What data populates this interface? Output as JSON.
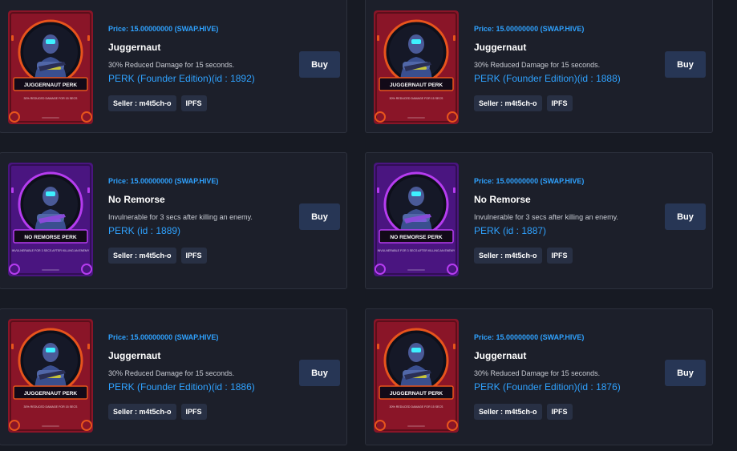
{
  "listings": [
    {
      "price": "Price: 15.00000000 (SWAP.HIVE)",
      "title": "Juggernaut",
      "description": "30% Reduced Damage for 15 seconds.",
      "nft": "PERK (Founder Edition)(id : 1892)",
      "seller": "Seller : m4t5ch-o",
      "ipfs": "IPFS",
      "buy": "Buy",
      "card_banner": "JUGGERNAUT PERK",
      "card_text": "30% REDUCED DAMAGE FOR 15 SECS",
      "theme": "juggernaut"
    },
    {
      "price": "Price: 15.00000000 (SWAP.HIVE)",
      "title": "Juggernaut",
      "description": "30% Reduced Damage for 15 seconds.",
      "nft": "PERK (Founder Edition)(id : 1888)",
      "seller": "Seller : m4t5ch-o",
      "ipfs": "IPFS",
      "buy": "Buy",
      "card_banner": "JUGGERNAUT PERK",
      "card_text": "30% REDUCED DAMAGE FOR 15 SECS",
      "theme": "juggernaut"
    },
    {
      "price": "Price: 15.00000000 (SWAP.HIVE)",
      "title": "No Remorse",
      "description": "Invulnerable for 3 secs after killing an enemy.",
      "nft": "PERK (id : 1889)",
      "seller": "Seller : m4t5ch-o",
      "ipfs": "IPFS",
      "buy": "Buy",
      "card_banner": "NO REMORSE PERK",
      "card_text": "INVULNERABLE FOR 3 SECS AFTER KILLING AN ENEMY",
      "theme": "remorse"
    },
    {
      "price": "Price: 15.00000000 (SWAP.HIVE)",
      "title": "No Remorse",
      "description": "Invulnerable for 3 secs after killing an enemy.",
      "nft": "PERK (id : 1887)",
      "seller": "Seller : m4t5ch-o",
      "ipfs": "IPFS",
      "buy": "Buy",
      "card_banner": "NO REMORSE PERK",
      "card_text": "INVULNERABLE FOR 3 SECS AFTER KILLING AN ENEMY",
      "theme": "remorse"
    },
    {
      "price": "Price: 15.00000000 (SWAP.HIVE)",
      "title": "Juggernaut",
      "description": "30% Reduced Damage for 15 seconds.",
      "nft": "PERK (Founder Edition)(id : 1886)",
      "seller": "Seller : m4t5ch-o",
      "ipfs": "IPFS",
      "buy": "Buy",
      "card_banner": "JUGGERNAUT PERK",
      "card_text": "30% REDUCED DAMAGE FOR 15 SECS",
      "theme": "juggernaut"
    },
    {
      "price": "Price: 15.00000000 (SWAP.HIVE)",
      "title": "Juggernaut",
      "description": "30% Reduced Damage for 15 seconds.",
      "nft": "PERK (Founder Edition)(id : 1876)",
      "seller": "Seller : m4t5ch-o",
      "ipfs": "IPFS",
      "buy": "Buy",
      "card_banner": "JUGGERNAUT PERK",
      "card_text": "30% REDUCED DAMAGE FOR 15 SECS",
      "theme": "juggernaut"
    }
  ],
  "colors": {
    "price": "#2fa2ff",
    "link": "#2fa2ff",
    "button": "#273655",
    "tag": "#283044",
    "juggernaut_bg": "#8a1528",
    "juggernaut_accent": "#e8541c",
    "remorse_bg": "#4a1580",
    "remorse_accent": "#b63cf0"
  }
}
